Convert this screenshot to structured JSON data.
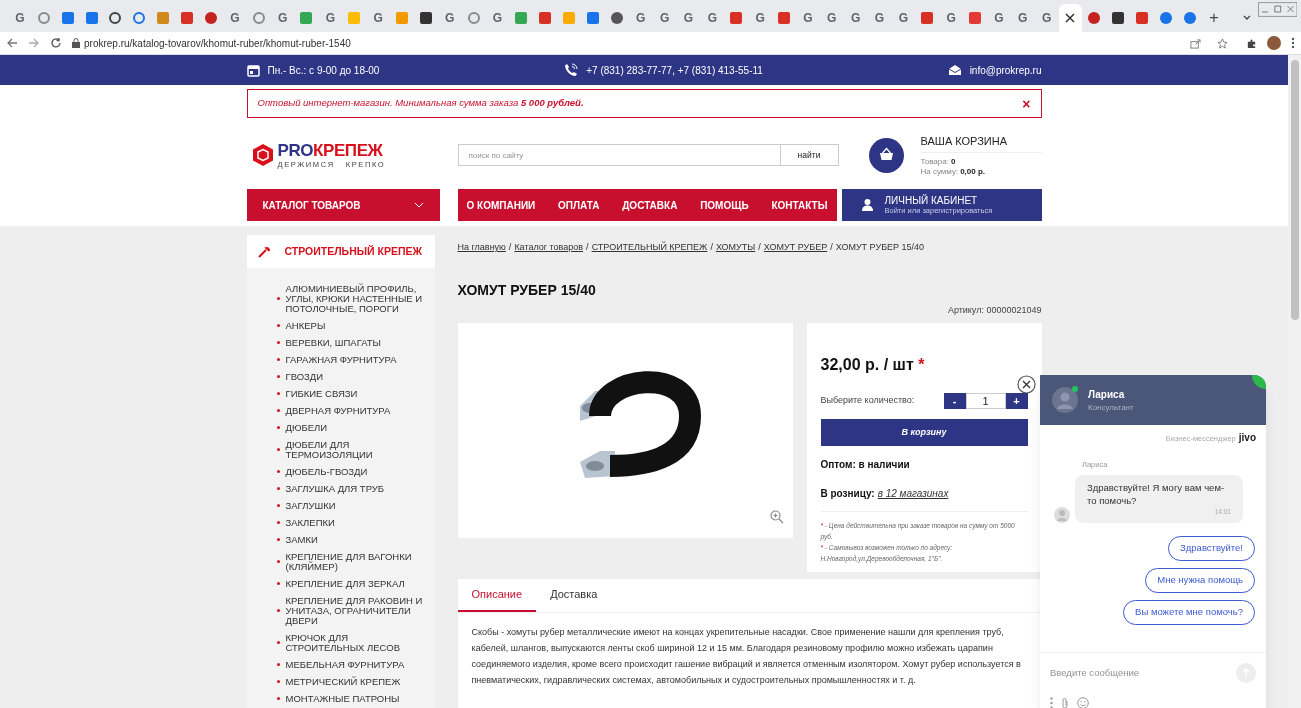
{
  "browser": {
    "tabs": [
      {
        "kind": "letter",
        "text": "G",
        "selected": false
      },
      {
        "kind": "ring",
        "color": "#8a8a8a",
        "selected": false
      },
      {
        "kind": "square",
        "color": "#1a73e8",
        "selected": false
      },
      {
        "kind": "square",
        "color": "#1a73e8",
        "selected": false
      },
      {
        "kind": "ring",
        "color": "#444444",
        "selected": false
      },
      {
        "kind": "ring",
        "color": "#1a73e8",
        "selected": false
      },
      {
        "kind": "square",
        "color": "#d08a1c",
        "selected": false
      },
      {
        "kind": "square",
        "color": "#d93025",
        "selected": false
      },
      {
        "kind": "circle",
        "color": "#c5221f",
        "selected": false
      },
      {
        "kind": "letter",
        "text": "G",
        "selected": false
      },
      {
        "kind": "ring",
        "color": "#8a8a8a",
        "selected": false
      },
      {
        "kind": "letter",
        "text": "G",
        "selected": false
      },
      {
        "kind": "square",
        "color": "#34a853",
        "selected": false
      },
      {
        "kind": "letter",
        "text": "G",
        "selected": false
      },
      {
        "kind": "square",
        "color": "#fbbc04",
        "selected": false
      },
      {
        "kind": "letter",
        "text": "G",
        "selected": false
      },
      {
        "kind": "square",
        "color": "#f29900",
        "selected": false
      },
      {
        "kind": "square",
        "color": "#333333",
        "selected": false
      },
      {
        "kind": "letter",
        "text": "G",
        "selected": false
      },
      {
        "kind": "ring",
        "color": "#8a8a8a",
        "selected": false
      },
      {
        "kind": "letter",
        "text": "G",
        "selected": false
      },
      {
        "kind": "square",
        "color": "#34a853",
        "selected": false
      },
      {
        "kind": "square",
        "color": "#d93025",
        "selected": false
      },
      {
        "kind": "square",
        "color": "#f9ab00",
        "selected": false
      },
      {
        "kind": "square",
        "color": "#1a73e8",
        "selected": false
      },
      {
        "kind": "circle",
        "color": "#555555",
        "selected": false
      },
      {
        "kind": "letter",
        "text": "G",
        "selected": false
      },
      {
        "kind": "letter",
        "text": "G",
        "selected": false
      },
      {
        "kind": "letter",
        "text": "G",
        "selected": false
      },
      {
        "kind": "letter",
        "text": "G",
        "selected": false
      },
      {
        "kind": "square",
        "color": "#d93025",
        "selected": false
      },
      {
        "kind": "letter",
        "text": "G",
        "selected": false
      },
      {
        "kind": "square",
        "color": "#d93025",
        "selected": false
      },
      {
        "kind": "letter",
        "text": "G",
        "selected": false
      },
      {
        "kind": "letter",
        "text": "G",
        "selected": false
      },
      {
        "kind": "letter",
        "text": "G",
        "selected": false
      },
      {
        "kind": "letter",
        "text": "G",
        "selected": false
      },
      {
        "kind": "letter",
        "text": "G",
        "selected": false
      },
      {
        "kind": "square",
        "color": "#d93025",
        "selected": false
      },
      {
        "kind": "letter",
        "text": "G",
        "selected": false
      },
      {
        "kind": "square",
        "color": "#e53935",
        "selected": false
      },
      {
        "kind": "letter",
        "text": "G",
        "selected": false
      },
      {
        "kind": "letter",
        "text": "G",
        "selected": false
      },
      {
        "kind": "letter",
        "text": "G",
        "selected": false
      },
      {
        "kind": "active",
        "selected": true
      },
      {
        "kind": "circle",
        "color": "#c5221f",
        "selected": false
      },
      {
        "kind": "square",
        "color": "#333333",
        "selected": false
      },
      {
        "kind": "square",
        "color": "#d93025",
        "selected": false
      },
      {
        "kind": "circle",
        "color": "#1a73e8",
        "selected": false
      },
      {
        "kind": "circle",
        "color": "#1a73e8",
        "selected": false
      }
    ],
    "new_tab": "+",
    "address": "prokrep.ru/katalog-tovarov/khomut-ruber/khomut-ruber-1540"
  },
  "top_bar": {
    "hours": "Пн.- Вс.: с 9-00 до 18-00",
    "phones": "+7 (831) 283-77-77, +7 (831) 413-55-11",
    "email": "info@prokrep.ru"
  },
  "notice": {
    "text": "Оптовый интернет-магазин. Минимальная сумма заказа **5 000 рублей.**",
    "close": "×"
  },
  "logo": {
    "part_a": "PRO",
    "part_b": "КРЕПЕЖ",
    "tagline": "ДЕРЖИМСЯ   КРЕПКО"
  },
  "search": {
    "placeholder": "поиск по сайту",
    "button": "найти"
  },
  "cart": {
    "title": "ВАША КОРЗИНА",
    "items_label": "Товара:",
    "items": "0",
    "sum_label": "На сумму:",
    "sum": "0,00 р."
  },
  "catalog_button": "КАТАЛОГ ТОВАРОВ",
  "menu": [
    "О КОМПАНИИ",
    "ОПЛАТА",
    "ДОСТАВКА",
    "ПОМОЩЬ",
    "КОНТАКТЫ"
  ],
  "account": {
    "title": "ЛИЧНЫЙ КАБИНЕТ",
    "subtitle": "Войти или зарегистрироваться"
  },
  "sidebar": {
    "heading": "СТРОИТЕЛЬНЫЙ КРЕПЕЖ",
    "items": [
      "АЛЮМИНИЕВЫЙ ПРОФИЛЬ, УГЛЫ, КРЮКИ НАСТЕННЫЕ И ПОТОЛОЧНЫЕ, ПОРОГИ",
      "АНКЕРЫ",
      "ВЕРЕВКИ, ШПАГАТЫ",
      "ГАРАЖНАЯ ФУРНИТУРА",
      "ГВОЗДИ",
      "ГИБКИЕ СВЯЗИ",
      "ДВЕРНАЯ ФУРНИТУРА",
      "ДЮБЕЛИ",
      "ДЮБЕЛИ ДЛЯ ТЕРМОИЗОЛЯЦИИ",
      "ДЮБЕЛЬ-ГВОЗДИ",
      "ЗАГЛУШКА ДЛЯ ТРУБ",
      "ЗАГЛУШКИ",
      "ЗАКЛЕПКИ",
      "ЗАМКИ",
      "КРЕПЛЕНИЕ ДЛЯ ВАГОНКИ (КЛЯЙМЕР)",
      "КРЕПЛЕНИЕ ДЛЯ ЗЕРКАЛ",
      "КРЕПЛЕНИЕ ДЛЯ РАКОВИН И УНИТАЗА, ОГРАНИЧИТЕЛИ ДВЕРИ",
      "КРЮЧОК ДЛЯ СТРОИТЕЛЬНЫХ ЛЕСОВ",
      "МЕБЕЛЬНАЯ ФУРНИТУРА",
      "МЕТРИЧЕСКИЙ КРЕПЕЖ",
      "МОНТАЖНЫЕ ПАТРОНЫ"
    ]
  },
  "breadcrumbs": {
    "separator": "/",
    "items": [
      {
        "label": "На главную",
        "kind": "link"
      },
      {
        "label": "Каталог товаров",
        "kind": "link"
      },
      {
        "label": "СТРОИТЕЛЬНЫЙ КРЕПЕЖ",
        "kind": "link"
      },
      {
        "label": "ХОМУТЫ",
        "kind": "link"
      },
      {
        "label": "ХОМУТ РУБЕР",
        "kind": "link"
      },
      {
        "label": "ХОМУТ РУБЕР 15/40",
        "kind": "current"
      }
    ]
  },
  "product": {
    "title": "ХОМУТ РУБЕР 15/40",
    "article": "Артикул: 00000021049",
    "price": "32,00 р. / шт",
    "price_mark": "*",
    "quantity_label": "Выберите количество:",
    "minus": "-",
    "quantity": "1",
    "plus": "+",
    "cart_button": "В корзину",
    "wholesale": "Оптом: в наличии",
    "retail_label": "В розницу:",
    "retail_link": "в 12 магазинах",
    "notes": [
      {
        "mark": "*",
        "text": " - Цена действительна при заказе товаров на сумму от 5000 руб."
      },
      {
        "mark": "*",
        "text": " - Самовывоз возможен только по адресу: Н.Новгород,ул.Деревообделочная, 1\"Б\"."
      }
    ]
  },
  "info_tabs": [
    {
      "label": "Описание",
      "selected": true
    },
    {
      "label": "Доставка",
      "selected": false
    }
  ],
  "description": "Скобы - хомуты рубер металлические имеют на концах укрепительные насадки. Свое применение нашли для крепления труб, кабелей, шлангов, выпускаются ленты скоб шириной 12 и 15 мм. Благодаря резиновому профилю можно избежать царапин соединяемого изделия, кроме всего происходит гашение вибраций и является отменным изолятором. Хомут рубер используется в пневматических, гидравлических системах, автомобильных и судостроительных промышленностях и т. д.",
  "chat": {
    "agent": "Лариса",
    "role": "Консультант",
    "online": true,
    "brand_text": "Бизнес-мессенджер",
    "brand": "jivo",
    "messages": [
      {
        "author": "Лариса",
        "text": "Здравствуйте! Я могу вам чем-то помочь?",
        "time": "14:01"
      }
    ],
    "quick_replies": [
      "Здравствуйте!",
      "Мне нужна помощь",
      "Вы можете мне помочь?"
    ],
    "placeholder": "Введите сообщение"
  }
}
